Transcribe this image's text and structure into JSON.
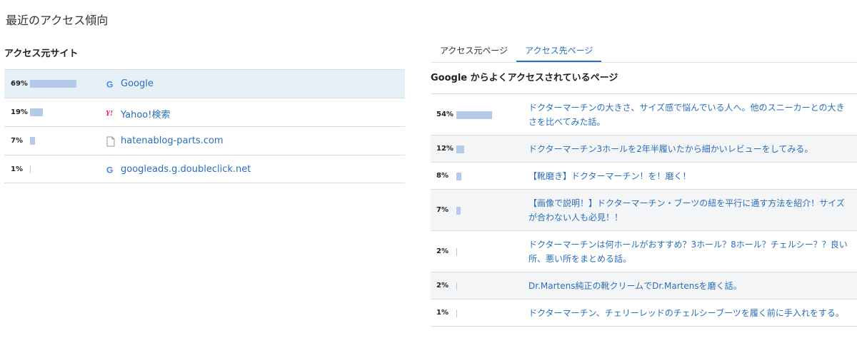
{
  "page_title": "最近のアクセス傾向",
  "sources": {
    "title": "アクセス元サイト",
    "rows": [
      {
        "pct": "69%",
        "value": 69,
        "icon": "google-icon",
        "label": "Google"
      },
      {
        "pct": "19%",
        "value": 19,
        "icon": "yahoo-icon",
        "label": "Yahoo!検索"
      },
      {
        "pct": "7%",
        "value": 7,
        "icon": "page-icon",
        "label": "hatenablog-parts.com"
      },
      {
        "pct": "1%",
        "value": 1,
        "icon": "google-icon",
        "label": "googleads.g.doubleclick.net"
      }
    ]
  },
  "tabs": [
    {
      "label": "アクセス元ページ",
      "active": false
    },
    {
      "label": "アクセス先ページ",
      "active": true
    }
  ],
  "destinations": {
    "title": "Google からよくアクセスされているページ",
    "rows": [
      {
        "pct": "54%",
        "value": 54,
        "label": "ドクターマーチンの大きさ、サイズ感で悩んでいる人へ。他のスニーカーとの大きさを比べてみた話。"
      },
      {
        "pct": "12%",
        "value": 12,
        "label": "ドクターマーチン3ホールを2年半履いたから細かいレビューをしてみる。"
      },
      {
        "pct": "8%",
        "value": 8,
        "label": "【靴磨き】ドクターマーチン！を！磨く！"
      },
      {
        "pct": "7%",
        "value": 7,
        "label": "【画像で説明！】ドクターマーチン・ブーツの紐を平行に通す方法を紹介！サイズが合わない人も必見！！"
      },
      {
        "pct": "2%",
        "value": 2,
        "label": "ドクターマーチンは何ホールがおすすめ？3ホール？8ホール？チェルシー？？良い所、悪い所をまとめる話。"
      },
      {
        "pct": "2%",
        "value": 2,
        "label": "Dr.Martens純正の靴クリームでDr.Martensを磨く話。"
      },
      {
        "pct": "1%",
        "value": 1,
        "label": "ドクターマーチン、チェリーレッドのチェルシーブーツを履く前に手入れをする。"
      }
    ]
  },
  "colors": {
    "link": "#2a6ebb",
    "bar": "#b3cbe8",
    "highlight": "#e6f0f7"
  }
}
